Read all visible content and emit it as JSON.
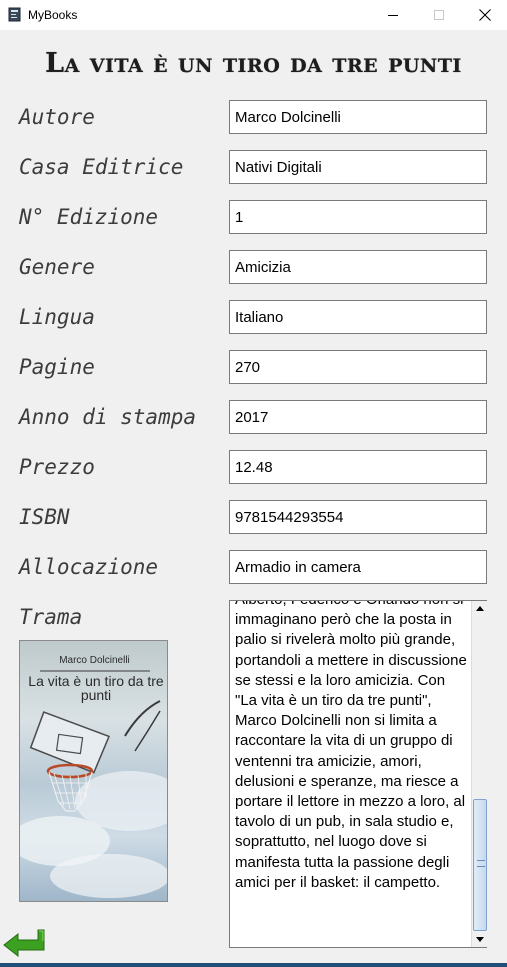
{
  "window": {
    "title": "MyBooks"
  },
  "book": {
    "title": "La vita è un tiro da tre punti",
    "cover": {
      "author": "Marco Dolcinelli",
      "title": "La vita è un tiro da tre punti"
    }
  },
  "fields": {
    "autore": {
      "label": "Autore",
      "value": "Marco Dolcinelli"
    },
    "casa_editrice": {
      "label": "Casa Editrice",
      "value": "Nativi Digitali"
    },
    "edizione": {
      "label": "N° Edizione",
      "value": "1"
    },
    "genere": {
      "label": "Genere",
      "value": "Amicizia"
    },
    "lingua": {
      "label": "Lingua",
      "value": "Italiano"
    },
    "pagine": {
      "label": "Pagine",
      "value": "270"
    },
    "anno": {
      "label": "Anno di stampa",
      "value": "2017"
    },
    "prezzo": {
      "label": "Prezzo",
      "value": "12.48"
    },
    "isbn": {
      "label": "ISBN",
      "value": "9781544293554"
    },
    "allocazione": {
      "label": "Allocazione",
      "value": "Armadio in camera"
    }
  },
  "trama": {
    "label": "Trama",
    "text": "Alberto, Federico e Orlando non si immaginano però che la posta in palio si rivelerà molto più grande, portandoli a mettere in discussione se stessi e la loro amicizia. Con \"La vita è un tiro da tre punti\", Marco Dolcinelli non si limita a raccontare la vita di un gruppo di ventenni tra amicizie, amori, delusioni e speranze, ma riesce a portare il lettore in mezzo a loro, al tavolo di un pub, in sala studio e, soprattutto, nel luogo dove si manifesta tutta la passione degli amici per il basket: il campetto."
  },
  "icons": {
    "app": "book-app-icon",
    "back": "back-arrow-icon"
  },
  "colors": {
    "back_arrow": "#3ca020",
    "scroll_thumb": "#c7d9f0",
    "bottom_edge": "#1f4e79"
  }
}
